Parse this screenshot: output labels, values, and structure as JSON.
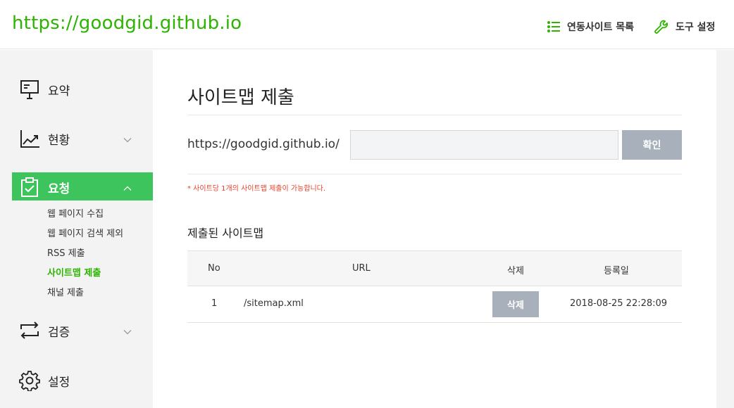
{
  "header": {
    "site_title": "https://goodgid.github.io",
    "linked_sites_label": "연동사이트 목록",
    "tool_settings_label": "도구 설정"
  },
  "sidebar": {
    "items": [
      {
        "label": "요약",
        "icon": "presentation-board-icon"
      },
      {
        "label": "현황",
        "icon": "line-chart-icon",
        "expandable": true
      },
      {
        "label": "요청",
        "icon": "clipboard-check-icon",
        "expandable": true,
        "active": true
      },
      {
        "label": "검증",
        "icon": "sync-arrows-icon",
        "expandable": true
      },
      {
        "label": "설정",
        "icon": "gear-icon"
      }
    ],
    "sub_items": [
      {
        "label": "웹 페이지 수집"
      },
      {
        "label": "웹 페이지 검색 제외"
      },
      {
        "label": "RSS 제출"
      },
      {
        "label": "사이트맵 제출",
        "active": true
      },
      {
        "label": "채널 제출"
      }
    ]
  },
  "main": {
    "title": "사이트맵 제출",
    "url_prefix": "https://goodgid.github.io/",
    "input_value": "",
    "confirm_label": "확인",
    "notice": "* 사이트당 1개의 사이트맵 제출이 가능합니다.",
    "submitted_title": "제출된 사이트맵",
    "table": {
      "headers": [
        "No",
        "URL",
        "삭제",
        "등록일"
      ],
      "rows": [
        {
          "no": "1",
          "url": "/sitemap.xml",
          "delete_label": "삭제",
          "date": "2018-08-25 22:28:09"
        }
      ]
    }
  },
  "colors": {
    "brand_green": "#2db400",
    "active_nav": "#3ec45c",
    "notice_red": "#e8412c",
    "button_gray": "#a7b0bb"
  }
}
